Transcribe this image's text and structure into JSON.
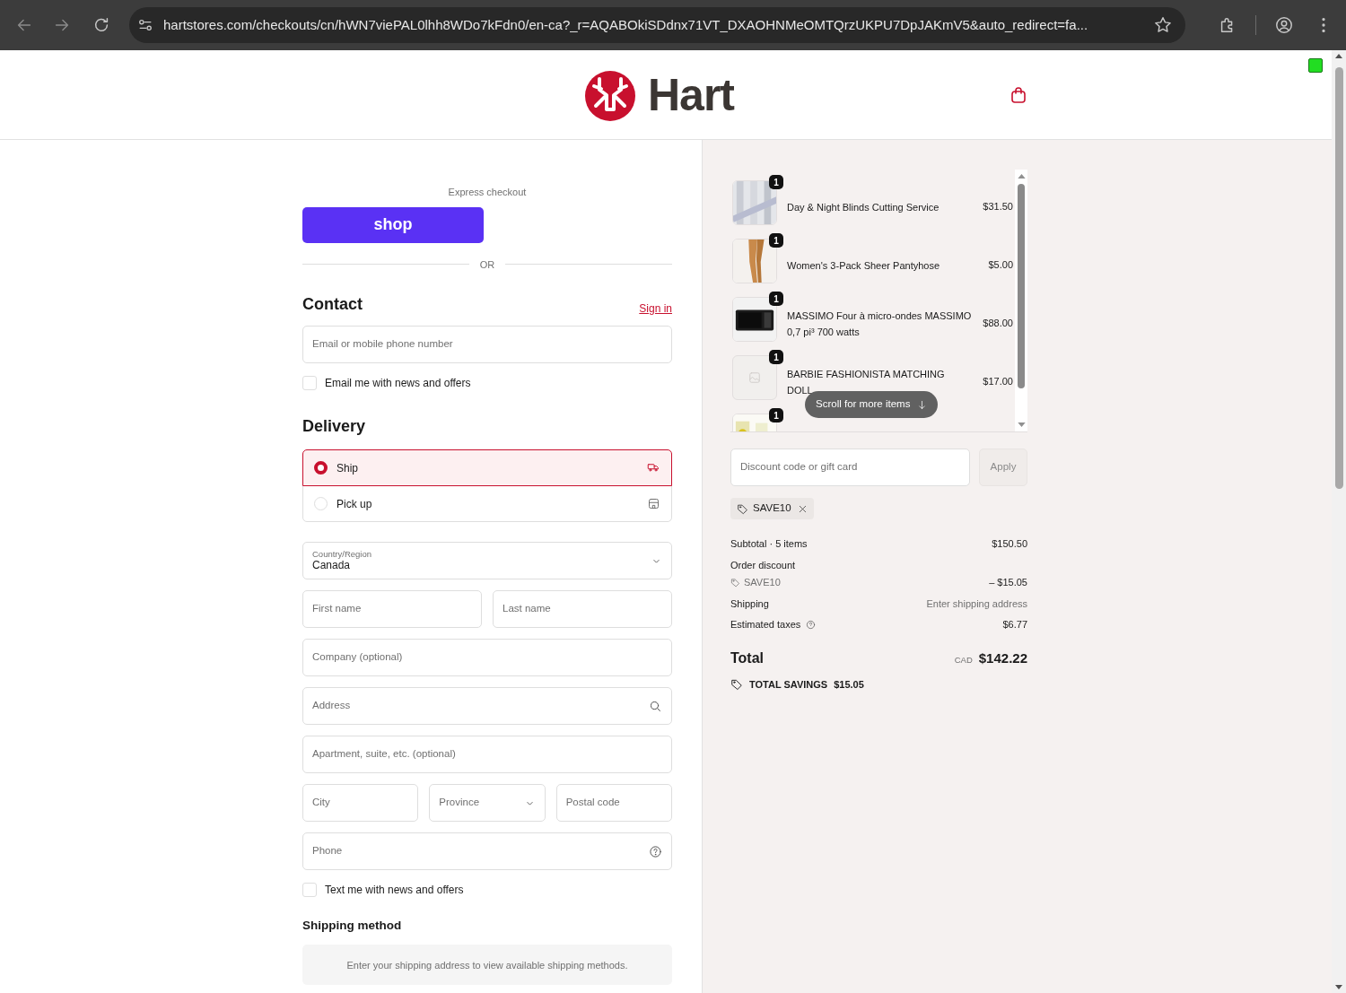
{
  "browser": {
    "url": "hartstores.com/checkouts/cn/hWN7viePAL0lhh8WDo7kFdn0/en-ca?_r=AQABOkiSDdnx71VT_DXAOHNMeOMTQrzUKPU7DpJAKmV5&auto_redirect=fa..."
  },
  "header": {
    "brand": "Hart"
  },
  "express": {
    "label": "Express checkout",
    "button": "shop",
    "divider": "OR"
  },
  "contact": {
    "title": "Contact",
    "sign_in": "Sign in",
    "placeholder": "Email or mobile phone number",
    "newsletter": {
      "label": "Email me with news and offers",
      "checked": false
    }
  },
  "delivery": {
    "title": "Delivery",
    "options": [
      {
        "label": "Ship",
        "kind": "ship",
        "selected": true
      },
      {
        "label": "Pick up",
        "kind": "pickup",
        "selected": false
      }
    ]
  },
  "address_rows": [
    {
      "fields": [
        {
          "kind": "labeled_select",
          "label": "Country/Region",
          "value": "Canada"
        }
      ]
    },
    {
      "fields": [
        {
          "kind": "input",
          "placeholder": "First name"
        },
        {
          "kind": "input",
          "placeholder": "Last name"
        }
      ]
    },
    {
      "fields": [
        {
          "kind": "input",
          "placeholder": "Company (optional)"
        }
      ]
    },
    {
      "fields": [
        {
          "kind": "search_input",
          "placeholder": "Address"
        }
      ]
    },
    {
      "fields": [
        {
          "kind": "input",
          "placeholder": "Apartment, suite, etc. (optional)"
        }
      ]
    },
    {
      "fields": [
        {
          "kind": "input",
          "placeholder": "City"
        },
        {
          "kind": "select",
          "placeholder": "Province"
        },
        {
          "kind": "input",
          "placeholder": "Postal code"
        }
      ]
    },
    {
      "fields": [
        {
          "kind": "help_input",
          "placeholder": "Phone"
        }
      ]
    }
  ],
  "sms": {
    "label": "Text me with news and offers",
    "checked": false
  },
  "shipping_method": {
    "title": "Shipping method",
    "message": "Enter your shipping address to view available shipping methods."
  },
  "summary": {
    "items": [
      {
        "title": "Day & Night Blinds Cutting Service",
        "price": "$31.50",
        "quantity": "1",
        "kind": "picture"
      },
      {
        "title": "Women's 3-Pack Sheer Pantyhose",
        "price": "$5.00",
        "quantity": "1",
        "kind": "picture"
      },
      {
        "title": "MASSIMO Four à micro-ondes MASSIMO 0,7 pi³ 700 watts",
        "price": "$88.00",
        "quantity": "1",
        "kind": "picture"
      },
      {
        "title": "BARBIE FASHIONISTA MATCHING DOLL",
        "price": "$17.00",
        "quantity": "1",
        "kind": "placeholder"
      },
      {
        "quantity": "1",
        "kind": "picture"
      }
    ],
    "scroll_hint": "Scroll for more items",
    "discount": {
      "placeholder": "Discount code or gift card",
      "button": "Apply",
      "disabled": true
    },
    "applied_codes": [
      {
        "code": "SAVE10"
      }
    ],
    "lines": [
      {
        "label": "Subtotal · 5 items",
        "value": "$150.50"
      },
      {
        "label": "Order discount",
        "code": "SAVE10",
        "value": "– $15.05"
      },
      {
        "label": "Shipping",
        "value": "Enter shipping address",
        "muted": true
      },
      {
        "label": "Estimated taxes",
        "value": "$6.77",
        "help": true
      }
    ],
    "total": {
      "label": "Total",
      "currency": "CAD",
      "amount": "$142.22"
    },
    "savings": {
      "label": "TOTAL SAVINGS",
      "amount": "$15.05"
    }
  }
}
